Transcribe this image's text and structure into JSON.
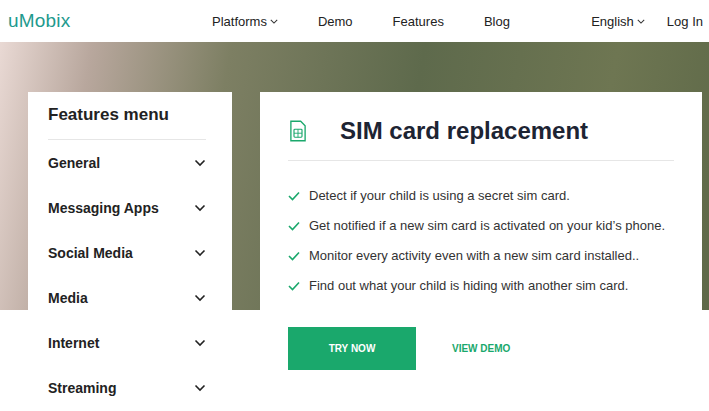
{
  "logo": {
    "text": "uMobix"
  },
  "nav": {
    "items": [
      {
        "label": "Platforms",
        "dropdown": true
      },
      {
        "label": "Demo",
        "dropdown": false
      },
      {
        "label": "Features",
        "dropdown": false
      },
      {
        "label": "Blog",
        "dropdown": false
      }
    ],
    "language": {
      "label": "English",
      "dropdown": true
    },
    "login": "Log In"
  },
  "features_menu": {
    "title": "Features menu",
    "items": [
      {
        "label": "General",
        "expanded": false
      },
      {
        "label": "Messaging Apps",
        "expanded": false
      },
      {
        "label": "Social Media",
        "expanded": false
      },
      {
        "label": "Media",
        "expanded": false
      },
      {
        "label": "Internet",
        "expanded": false
      },
      {
        "label": "Streaming",
        "expanded": false
      }
    ]
  },
  "feature": {
    "title": "SIM card replacement",
    "points": [
      "Detect if your child is using a secret sim card.",
      "Get notified if a new sim card is activated on your kid’s phone.",
      "Monitor every activity even with a new sim card installed..",
      "Find out what your child is hiding with another sim card."
    ],
    "buttons": {
      "primary": "TRY NOW",
      "secondary": "VIEW DEMO"
    }
  }
}
